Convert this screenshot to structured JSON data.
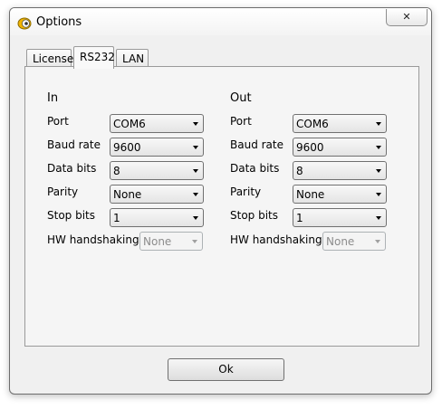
{
  "window": {
    "title": "Options",
    "close_label": "✕"
  },
  "tabs": [
    {
      "label": "License",
      "active": false
    },
    {
      "label": "RS232",
      "active": true
    },
    {
      "label": "LAN",
      "active": false
    }
  ],
  "in": {
    "heading": "In",
    "port": {
      "label": "Port",
      "value": "COM6"
    },
    "baud_rate": {
      "label": "Baud rate",
      "value": "9600"
    },
    "data_bits": {
      "label": "Data bits",
      "value": "8"
    },
    "parity": {
      "label": "Parity",
      "value": "None"
    },
    "stop_bits": {
      "label": "Stop bits",
      "value": "1"
    },
    "hw_handshaking": {
      "label": "HW handshaking",
      "value": "None",
      "enabled": false
    }
  },
  "out": {
    "heading": "Out",
    "port": {
      "label": "Port",
      "value": "COM6"
    },
    "baud_rate": {
      "label": "Baud rate",
      "value": "9600"
    },
    "data_bits": {
      "label": "Data bits",
      "value": "8"
    },
    "parity": {
      "label": "Parity",
      "value": "None"
    },
    "stop_bits": {
      "label": "Stop bits",
      "value": "1"
    },
    "hw_handshaking": {
      "label": "HW handshaking",
      "value": "None",
      "enabled": false
    }
  },
  "buttons": {
    "ok_label": "Ok"
  }
}
